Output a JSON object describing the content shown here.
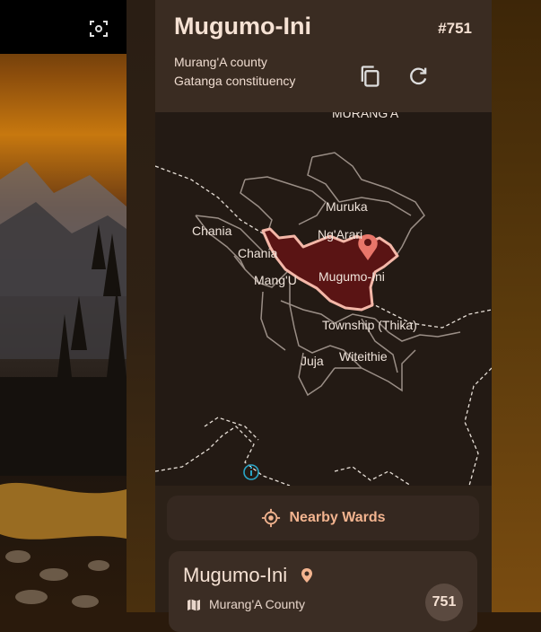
{
  "header": {
    "title": "Mugumo-Ini",
    "ward_number": "#751",
    "county": "Murang'A county",
    "constituency": "Gatanga constituency"
  },
  "map": {
    "labels": {
      "murangA": "MURANG'A",
      "muruka": "Muruka",
      "ngarari": "Ng'Arari",
      "chania1": "Chania",
      "chania2": "Chania",
      "mangu": "Mang'U",
      "mugumoIni": "Mugumo-Ini",
      "township": "Township (Thika)",
      "juja": "Juja",
      "witeithie": "Witeithie"
    }
  },
  "nearby": {
    "label": "Nearby Wards"
  },
  "result": {
    "name": "Mugumo-Ini",
    "county": "Murang'A County",
    "badge": "751"
  },
  "colors": {
    "accent": "#f3b48f",
    "ward_fill": "#5a1414",
    "ward_outline": "#f4b7a8",
    "pin": "#e8766a"
  },
  "icons": {
    "screenshot": "screenshot-icon",
    "copy": "copy-icon",
    "refresh": "refresh-icon",
    "crosshair": "crosshair-icon",
    "pin": "location-pin-icon",
    "map": "map-icon",
    "info": "info-icon"
  }
}
